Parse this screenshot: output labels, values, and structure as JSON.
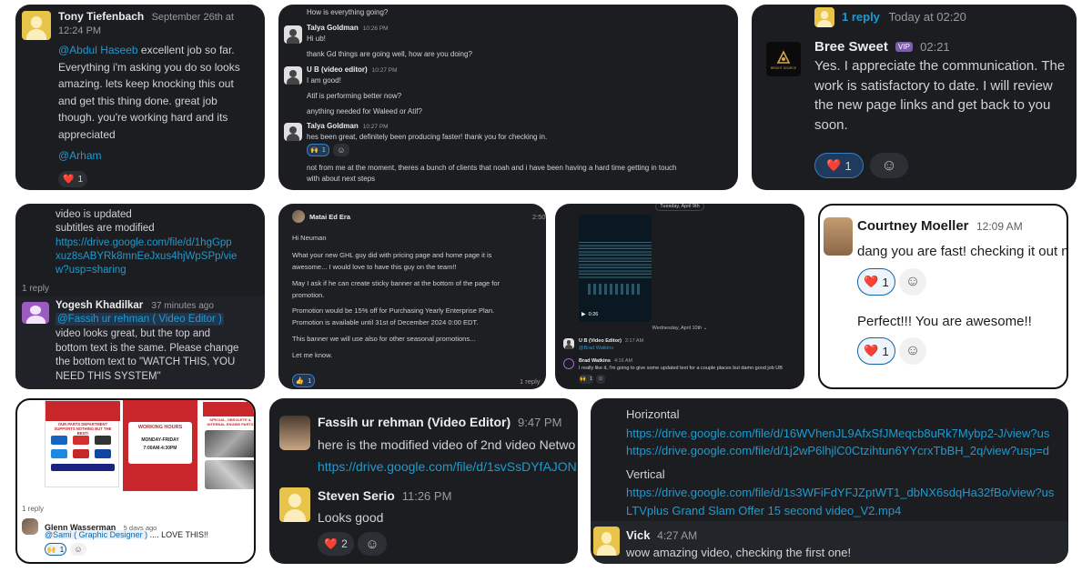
{
  "card1": {
    "name": "Tony Tiefenbach",
    "time_line1": "September 26th at",
    "time_line2": "12:24 PM",
    "mention1": "@Abdul Haseeb",
    "body_first": " excellent job so far.",
    "body_lines": [
      "Everything i'm asking you do so looks",
      "amazing.  lets keep knocking this out",
      "and get this thing done.  great job",
      "though. you're working hard and its",
      "appreciated"
    ],
    "mention2": "@Arham",
    "reaction_emoji": "❤️",
    "reaction_count": "1"
  },
  "card2": {
    "top_line": "How is everything going?",
    "msg1_name": "Talya Goldman",
    "msg1_time": "10:26 PM",
    "msg1_lines": [
      "Hi ub!",
      "thank Gd things are going well, how are you doing?"
    ],
    "msg2_name": "U B (video editor)",
    "msg2_time": "10:27 PM",
    "msg2_lines": [
      "I am good!",
      "Atif is performing better now?",
      "anything needed for Waleed or Atif?"
    ],
    "msg3_name": "Talya Goldman",
    "msg3_time": "10:27 PM",
    "msg3_line": "hes been great, definitely been producing faster! thank you for checking in.",
    "reaction_emoji": "🙌",
    "reaction_count": "1",
    "bottom_lines": [
      "not from me at the moment, theres a bunch of clients that noah and i have been having a hard time getting in touch",
      "with about next steps"
    ]
  },
  "card3": {
    "reply_count": "1 reply",
    "reply_time": "Today at 02:20",
    "name": "Bree Sweet",
    "badge": "VIP",
    "time": "02:21",
    "logo_text": "BRIGHT SOURCE",
    "body_lines": [
      "Yes. I appreciate the communication. The",
      "work is satisfactory to date. I will review",
      "the new page links and get back to you",
      "soon."
    ],
    "reaction_emoji": "❤️",
    "reaction_count": "1"
  },
  "card4": {
    "lines_top": [
      "video is updated",
      "subtitles are modified"
    ],
    "link_lines": [
      "https://drive.google.com/file/d/1hgGpp",
      "xuz8sABYRk8mnEeJxus4hjWpSPp/vie",
      "w?usp=sharing"
    ],
    "reply_count": "1 reply",
    "name": "Yogesh Khadilkar",
    "time": "37 minutes ago",
    "mention": "@Fassih ur rehman ( Video Editor )",
    "body_lines": [
      "video looks great, but the top and",
      "bottom text is the same. Please change",
      "the bottom text to \"WATCH THIS, YOU",
      "NEED THIS SYSTEM\""
    ]
  },
  "card5": {
    "name": "Matai Ed Era",
    "time": "2:50",
    "greeting": "Hi Neuman",
    "para1": [
      "What your new GHL guy did with pricing page and home page it is",
      "awesome... I would love to have this guy on the team!!"
    ],
    "para2": [
      "May I ask if he can create sticky banner at the bottom of the page for",
      "promotion."
    ],
    "para3": [
      "Promotion would be 15% off for Purchasing Yearly  Enterprise Plan.",
      "Promotion is available until 31st of December 2024 0:00 EDT."
    ],
    "para4": "This banner we will use also for other seasonal promotions...",
    "para5": "Let me know.",
    "reaction_emoji": "👍",
    "reaction_count": "1",
    "reply_count": "1 reply"
  },
  "card6": {
    "date_top": "Tuesday, April 9th",
    "video_duration": "0:26",
    "date_mid": "Wednesday, April 10th",
    "msg1_name": "U B (Video Editor)",
    "msg1_time": "2:17 AM",
    "msg1_mention": "@Brad Watkins",
    "msg2_name": "Brad Watkins",
    "msg2_time": "4:16 AM",
    "msg2_line": "I really like it, I'm going to give some updated text for a couple places but damn good job UB",
    "reaction_emoji": "🙌",
    "reaction_count": "1"
  },
  "card7": {
    "name": "Courtney Moeller",
    "time": "12:09 AM",
    "line1": "dang you are fast! checking it out now",
    "line2": "Perfect!!! You are awesome!!",
    "reaction_emoji": "❤️",
    "reaction_count": "1",
    "reaction2_count": "1"
  },
  "card8": {
    "banner_text": "OUR PARTS DEPARTMENT SUPPORTS NOTHING BUT THE BEST!",
    "hours_title": "WORKING HOURS",
    "hours_days": "MONDAY-FRIDAY",
    "hours_time": "7:00AM-4:30PM",
    "special_text": "SPECIAL, OBSOLETE & INTERNAL ENGINE PARTS",
    "reply_count": "1 reply",
    "name": "Glenn Wasserman",
    "time": "5 days ago",
    "mention": "@Sami ( Graphic Designer )",
    "body": " .... LOVE THIS!!",
    "reaction_emoji": "🙌",
    "reaction_count": "1"
  },
  "card9": {
    "msg1_name": "Fassih ur rehman (Video Editor)",
    "msg1_time": "9:47 PM",
    "msg1_text": "here is the modified video of 2nd video Netwo",
    "msg1_link": "https://drive.google.com/file/d/1svSsDYfAJON",
    "msg2_name": "Steven Serio",
    "msg2_time": "11:26 PM",
    "msg2_text": "Looks good",
    "reaction_emoji": "❤️",
    "reaction_count": "2"
  },
  "card10": {
    "h_label": "Horizontal",
    "h_link1": "https://drive.google.com/file/d/16WVhenJL9AfxSfJMeqcb8uRk7Mybp2-J/view?us",
    "h_link2": "https://drive.google.com/file/d/1j2wP6lhjlC0Ctzihtun6YYcrxTbBH_2q/view?usp=d",
    "v_label": "Vertical",
    "v_link": "https://drive.google.com/file/d/1s3WFiFdYFJZptWT1_dbNX6sdqHa32fBo/view?us",
    "v_filename": "LTVplus Grand Slam Offer 15 second video_V2.mp4",
    "name": "Vick",
    "time": "4:27 AM",
    "text": "wow amazing video, checking the first one!"
  }
}
